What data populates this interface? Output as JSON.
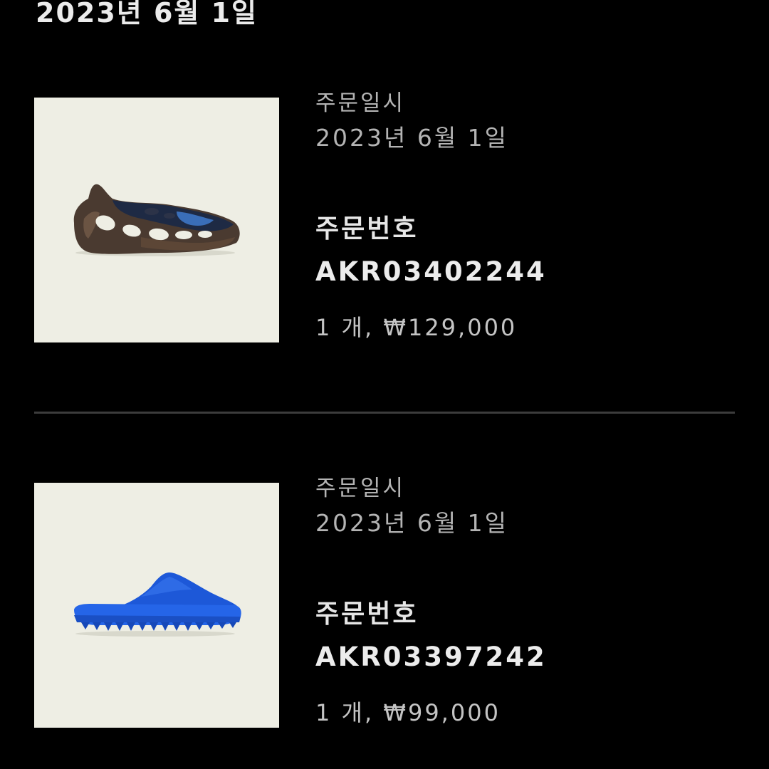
{
  "section": {
    "date": "2023년 6월 1일"
  },
  "orders": [
    {
      "date_label": "주문일시",
      "date_value": "2023년 6월 1일",
      "number_label": "주문번호",
      "number_value": "AKR03402244",
      "quantity_price": "1 개, ₩129,000",
      "product_image": "yeezy-foam-runner-shoe"
    },
    {
      "date_label": "주문일시",
      "date_value": "2023년 6월 1일",
      "number_label": "주문번호",
      "number_value": "AKR03397242",
      "quantity_price": "1 개, ₩99,000",
      "product_image": "yeezy-slide-blue"
    }
  ],
  "colors": {
    "background": "#000000",
    "thumbnail_bg": "#eeeee4",
    "divider": "#3c3c3c",
    "slide_blue": "#1f5fe0"
  }
}
